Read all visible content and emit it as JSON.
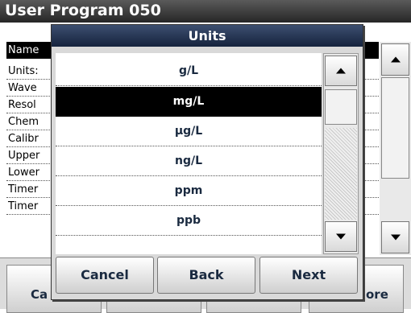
{
  "window": {
    "title": "User Program   050"
  },
  "background_list": [
    {
      "label": "Name",
      "selected": true
    },
    {
      "label": "Units:",
      "selected": false
    },
    {
      "label": "Wave",
      "selected": false
    },
    {
      "label": "Resol",
      "selected": false
    },
    {
      "label": "Chem",
      "selected": false
    },
    {
      "label": "Calibr",
      "selected": false
    },
    {
      "label": "Upper",
      "selected": false
    },
    {
      "label": "Lower",
      "selected": false
    },
    {
      "label": "Timer",
      "selected": false
    },
    {
      "label": "Timer",
      "selected": false
    }
  ],
  "background_buttons": {
    "cancel_label": "Ca",
    "more_label": "ore"
  },
  "icons": {
    "up": "arrow-up-icon",
    "down": "arrow-down-icon"
  },
  "dialog": {
    "title": "Units",
    "items": [
      {
        "label": "g/L",
        "selected": false
      },
      {
        "label": "mg/L",
        "selected": true
      },
      {
        "label": "µg/L",
        "selected": false
      },
      {
        "label": "ng/L",
        "selected": false
      },
      {
        "label": "ppm",
        "selected": false
      },
      {
        "label": "ppb",
        "selected": false
      }
    ],
    "buttons": {
      "cancel": "Cancel",
      "back": "Back",
      "next": "Next"
    }
  },
  "colors": {
    "dialog_title_bg": "#15233d",
    "selected_bg": "#000000",
    "button_text": "#1a2a40"
  }
}
